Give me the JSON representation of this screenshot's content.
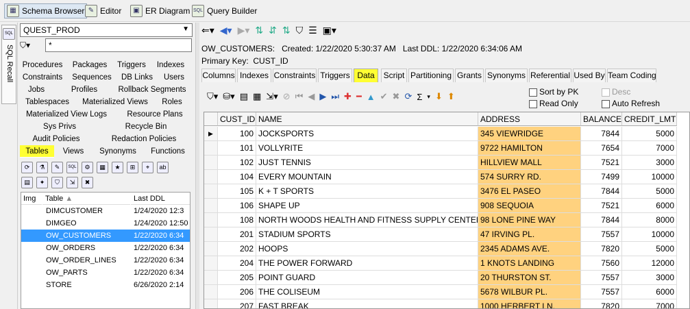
{
  "toolbar": {
    "items": [
      {
        "label": "Schema Browser",
        "icon": "schema-browser-icon",
        "active": true
      },
      {
        "label": "Editor",
        "icon": "editor-icon"
      },
      {
        "label": "ER Diagram",
        "icon": "er-diagram-icon"
      },
      {
        "label": "Query Builder",
        "icon": "query-builder-icon"
      }
    ],
    "sql_glyph": "SQL"
  },
  "sidebar": {
    "sql_recall": "SQL Recall",
    "sql_glyph": "SQL"
  },
  "left": {
    "schema": "QUEST_PROD",
    "filter_value": "*",
    "object_tab_rows": [
      [
        "Procedures",
        "Packages",
        "Triggers",
        "Indexes"
      ],
      [
        "Constraints",
        "Sequences",
        "DB Links",
        "Users"
      ],
      [
        "Jobs",
        "Profiles",
        "Rollback Segments"
      ],
      [
        "Tablespaces",
        "Materialized Views",
        "Roles"
      ],
      [
        "Materialized View Logs",
        "Resource Plans"
      ],
      [
        "Sys Privs",
        "Recycle Bin"
      ],
      [
        "Audit Policies",
        "Redaction Policies"
      ],
      [
        "Tables",
        "Views",
        "Synonyms",
        "Functions"
      ]
    ],
    "selected_object_tab": "Tables",
    "list_headers": {
      "img": "Img",
      "table": "Table",
      "last_ddl": "Last DDL"
    },
    "tables": [
      {
        "name": "DIMCUSTOMER",
        "last_ddl": "1/24/2020 12:3"
      },
      {
        "name": "DIMGEO",
        "last_ddl": "1/24/2020 12:50"
      },
      {
        "name": "OW_CUSTOMERS",
        "last_ddl": "1/22/2020 6:34",
        "selected": true
      },
      {
        "name": "OW_ORDERS",
        "last_ddl": "1/22/2020 6:34"
      },
      {
        "name": "OW_ORDER_LINES",
        "last_ddl": "1/22/2020 6:34"
      },
      {
        "name": "OW_PARTS",
        "last_ddl": "1/22/2020 6:34"
      },
      {
        "name": "STORE",
        "last_ddl": "6/26/2020 2:14"
      }
    ]
  },
  "right": {
    "info_line": "OW_CUSTOMERS:   Created: 1/22/2020 5:30:37 AM   Last DDL: 1/22/2020 6:34:06 AM",
    "pk_label": "Primary Key:",
    "pk_value": "CUST_ID",
    "detail_tabs": [
      "Columns",
      "Indexes",
      "Constraints",
      "Triggers",
      "Data",
      "Script",
      "Partitioning",
      "Grants",
      "Synonyms",
      "Referential",
      "Used By",
      "Team Coding"
    ],
    "selected_detail_tab": "Data",
    "data_toolbar_sum_glyph": "Σ",
    "options": {
      "sort_by_pk": "Sort by PK",
      "read_only": "Read Only",
      "desc": "Desc",
      "auto_refresh": "Auto Refresh"
    },
    "grid": {
      "columns": [
        "CUST_ID",
        "NAME",
        "ADDRESS",
        "BALANCE",
        "CREDIT_LMT"
      ],
      "rows": [
        [
          "100",
          "JOCKSPORTS",
          "345 VIEWRIDGE",
          "7844",
          "5000"
        ],
        [
          "101",
          "VOLLYRITE",
          "9722 HAMILTON",
          "7654",
          "7000"
        ],
        [
          "102",
          "JUST TENNIS",
          "HILLVIEW MALL",
          "7521",
          "3000"
        ],
        [
          "104",
          "EVERY MOUNTAIN",
          "574 SURRY RD.",
          "7499",
          "10000"
        ],
        [
          "105",
          "K + T SPORTS",
          "3476 EL PASEO",
          "7844",
          "5000"
        ],
        [
          "106",
          "SHAPE UP",
          "908 SEQUOIA",
          "7521",
          "6000"
        ],
        [
          "108",
          "NORTH WOODS HEALTH AND FITNESS SUPPLY CENTER",
          "98 LONE PINE WAY",
          "7844",
          "8000"
        ],
        [
          "201",
          "STADIUM SPORTS",
          "47 IRVING PL.",
          "7557",
          "10000"
        ],
        [
          "202",
          "HOOPS",
          "2345 ADAMS AVE.",
          "7820",
          "5000"
        ],
        [
          "204",
          "THE POWER FORWARD",
          "1 KNOTS LANDING",
          "7560",
          "12000"
        ],
        [
          "205",
          "POINT GUARD",
          "20 THURSTON ST.",
          "7557",
          "3000"
        ],
        [
          "206",
          "THE COLISEUM",
          "5678 WILBUR PL.",
          "7557",
          "6000"
        ],
        [
          "207",
          "FAST BREAK",
          "1000 HERBERT LN.",
          "7820",
          "7000"
        ]
      ],
      "highlight_color": "#ffd27f"
    }
  }
}
